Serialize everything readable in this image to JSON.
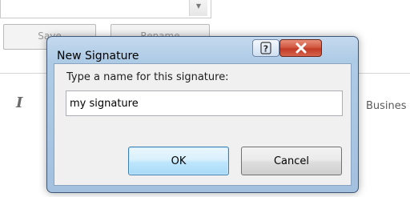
{
  "background": {
    "save_label": "Save",
    "rename_label": "Rename",
    "italic_glyph": "I",
    "font_combo_text": "Busines"
  },
  "dialog": {
    "title": "New Signature",
    "prompt_label": "Type a name for this signature:",
    "name_value": "my signature",
    "ok_label": "OK",
    "cancel_label": "Cancel"
  }
}
